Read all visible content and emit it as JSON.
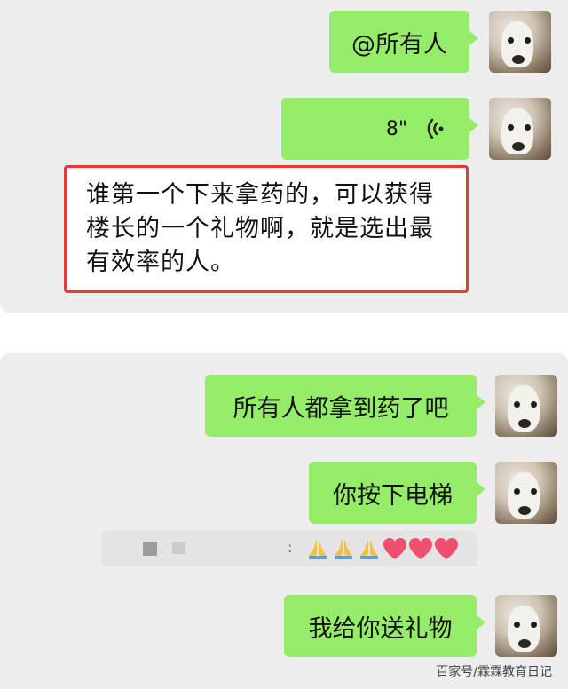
{
  "chat": {
    "messages": [
      {
        "type": "text",
        "text": "@所有人"
      },
      {
        "type": "voice",
        "duration": "8\""
      },
      {
        "type": "text",
        "text": "所有人都拿到药了吧"
      },
      {
        "type": "text",
        "text": "你按下电梯"
      },
      {
        "type": "text",
        "text": "我给你送礼物"
      }
    ],
    "notice": {
      "lines": [
        "谁第一个下来拿药的，可以获得",
        "楼长的一个礼物啊，就是选出最",
        "有效率的人。"
      ]
    },
    "blurred_row": {
      "separator": ":",
      "emoji": [
        "folded-hands",
        "folded-hands",
        "folded-hands",
        "heart",
        "heart",
        "heart"
      ]
    }
  },
  "colors": {
    "bubble_green": "#95ec69",
    "background": "#ededed",
    "highlight_border": "#e23b3b",
    "heart": "#ef4f6e"
  },
  "watermark": "百家号/霖霖教育日记"
}
